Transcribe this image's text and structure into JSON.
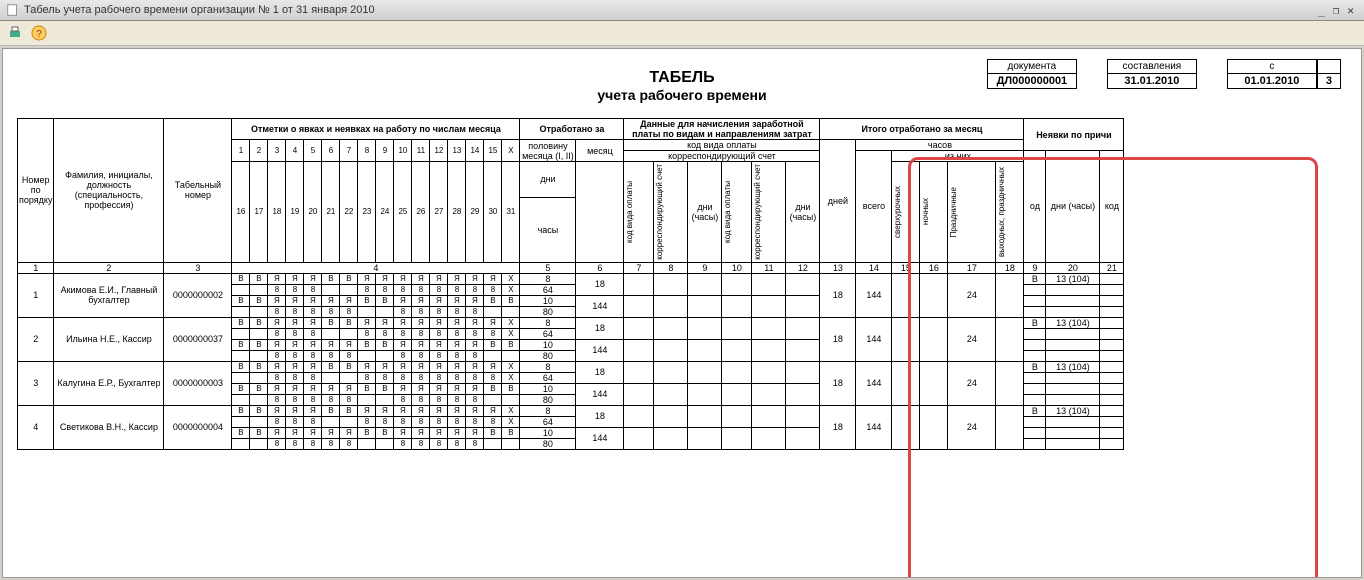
{
  "window": {
    "title": "Табель учета рабочего времени организации № 1 от 31 января 2010"
  },
  "meta": {
    "doc_h": "документа",
    "doc_v": "ДЛ000000001",
    "comp_h": "составления",
    "comp_v": "31.01.2010",
    "from_h": "с",
    "from_v": "01.01.2010",
    "extra": "3"
  },
  "title1": "ТАБЕЛЬ",
  "title2": "учета  рабочего времени",
  "hdr": {
    "num": "Номер по порядку",
    "fio": "Фамилия, инициалы, должность (специальность, профессия)",
    "tab": "Табельный номер",
    "marks": "Отметки о явках и неявках на работу по числам месяца",
    "worked": "Отработано за",
    "half": "половину месяца (I, II)",
    "month": "месяц",
    "days": "дни",
    "hours": "часы",
    "pay": "Данные для начисления заработной платы по видам и направлениям затрат",
    "code": "код вида оплаты",
    "acc": "корреспондирующий счет",
    "kvo": "код вида оплаты",
    "ks": "корреспондирующий счет",
    "dh": "дни (часы)",
    "totals": "Итого отработано за месяц",
    "th": "часов",
    "ofthem": "из них",
    "tdays": "дней",
    "tall": "всего",
    "over": "сверхурочных",
    "night": "ночных",
    "hol": "Праздничные",
    "wkhol": "выходных, праздничных",
    "absence": "Неявки по причи",
    "kod": "од",
    "absdays": "дни (часы)",
    "kod2": "код"
  },
  "days1": [
    "1",
    "2",
    "3",
    "4",
    "5",
    "6",
    "7",
    "8",
    "9",
    "10",
    "11",
    "12",
    "13",
    "14",
    "15",
    "Х"
  ],
  "days2": [
    "16",
    "17",
    "18",
    "19",
    "20",
    "21",
    "22",
    "23",
    "24",
    "25",
    "26",
    "27",
    "28",
    "29",
    "30",
    "31"
  ],
  "colnums": [
    "1",
    "2",
    "3",
    "4",
    "5",
    "6",
    "7",
    "8",
    "9",
    "10",
    "11",
    "12",
    "13",
    "14",
    "15",
    "16",
    "17",
    "18",
    "9",
    "20",
    "21"
  ],
  "rows": [
    {
      "n": "1",
      "name": "Акимова Е.И., Главный бухгалтер",
      "tab": "0000000002",
      "r1": [
        "В",
        "В",
        "Я",
        "Я",
        "Я",
        "В",
        "В",
        "Я",
        "Я",
        "Я",
        "Я",
        "Я",
        "Я",
        "Я",
        "Я",
        "Х"
      ],
      "r1h": [
        "",
        "",
        "8",
        "8",
        "8",
        "",
        "",
        "8",
        "8",
        "8",
        "8",
        "8",
        "8",
        "8",
        "8",
        "Х"
      ],
      "r2": [
        "В",
        "В",
        "Я",
        "Я",
        "Я",
        "Я",
        "Я",
        "В",
        "В",
        "Я",
        "Я",
        "Я",
        "Я",
        "Я",
        "В",
        "В"
      ],
      "r2h": [
        "",
        "",
        "8",
        "8",
        "8",
        "8",
        "8",
        "",
        "",
        "8",
        "8",
        "8",
        "8",
        "8",
        "",
        ""
      ],
      "half": [
        "8",
        "64",
        "10",
        "80"
      ],
      "month": [
        "18",
        "",
        "144",
        ""
      ],
      "tdays": "18",
      "tall": "144",
      "thol": "24",
      "abs_k": "В",
      "abs_v": "13 (104)"
    },
    {
      "n": "2",
      "name": "Ильина Н.Е., Кассир",
      "tab": "0000000037",
      "r1": [
        "В",
        "В",
        "Я",
        "Я",
        "Я",
        "В",
        "В",
        "Я",
        "Я",
        "Я",
        "Я",
        "Я",
        "Я",
        "Я",
        "Я",
        "Х"
      ],
      "r1h": [
        "",
        "",
        "8",
        "8",
        "8",
        "",
        "",
        "8",
        "8",
        "8",
        "8",
        "8",
        "8",
        "8",
        "8",
        "Х"
      ],
      "r2": [
        "В",
        "В",
        "Я",
        "Я",
        "Я",
        "Я",
        "Я",
        "В",
        "В",
        "Я",
        "Я",
        "Я",
        "Я",
        "Я",
        "В",
        "В"
      ],
      "r2h": [
        "",
        "",
        "8",
        "8",
        "8",
        "8",
        "8",
        "",
        "",
        "8",
        "8",
        "8",
        "8",
        "8",
        "",
        ""
      ],
      "half": [
        "8",
        "64",
        "10",
        "80"
      ],
      "month": [
        "18",
        "",
        "144",
        ""
      ],
      "tdays": "18",
      "tall": "144",
      "thol": "24",
      "abs_k": "В",
      "abs_v": "13 (104)"
    },
    {
      "n": "3",
      "name": "Калугина Е.Р., Бухгалтер",
      "tab": "0000000003",
      "r1": [
        "В",
        "В",
        "Я",
        "Я",
        "Я",
        "В",
        "В",
        "Я",
        "Я",
        "Я",
        "Я",
        "Я",
        "Я",
        "Я",
        "Я",
        "Х"
      ],
      "r1h": [
        "",
        "",
        "8",
        "8",
        "8",
        "",
        "",
        "8",
        "8",
        "8",
        "8",
        "8",
        "8",
        "8",
        "8",
        "Х"
      ],
      "r2": [
        "В",
        "В",
        "Я",
        "Я",
        "Я",
        "Я",
        "Я",
        "В",
        "В",
        "Я",
        "Я",
        "Я",
        "Я",
        "Я",
        "В",
        "В"
      ],
      "r2h": [
        "",
        "",
        "8",
        "8",
        "8",
        "8",
        "8",
        "",
        "",
        "8",
        "8",
        "8",
        "8",
        "8",
        "",
        ""
      ],
      "half": [
        "8",
        "64",
        "10",
        "80"
      ],
      "month": [
        "18",
        "",
        "144",
        ""
      ],
      "tdays": "18",
      "tall": "144",
      "thol": "24",
      "abs_k": "В",
      "abs_v": "13 (104)"
    },
    {
      "n": "4",
      "name": "Светикова В.Н., Кассир",
      "tab": "0000000004",
      "r1": [
        "В",
        "В",
        "Я",
        "Я",
        "Я",
        "В",
        "В",
        "Я",
        "Я",
        "Я",
        "Я",
        "Я",
        "Я",
        "Я",
        "Я",
        "Х"
      ],
      "r1h": [
        "",
        "",
        "8",
        "8",
        "8",
        "",
        "",
        "8",
        "8",
        "8",
        "8",
        "8",
        "8",
        "8",
        "8",
        "Х"
      ],
      "r2": [
        "В",
        "В",
        "Я",
        "Я",
        "Я",
        "Я",
        "Я",
        "В",
        "В",
        "Я",
        "Я",
        "Я",
        "Я",
        "Я",
        "В",
        "В"
      ],
      "r2h": [
        "",
        "",
        "8",
        "8",
        "8",
        "8",
        "8",
        "",
        "",
        "8",
        "8",
        "8",
        "8",
        "8",
        "",
        ""
      ],
      "half": [
        "8",
        "64",
        "10",
        "80"
      ],
      "month": [
        "18",
        "",
        "144",
        ""
      ],
      "tdays": "18",
      "tall": "144",
      "thol": "24",
      "abs_k": "В",
      "abs_v": "13 (104)"
    }
  ]
}
